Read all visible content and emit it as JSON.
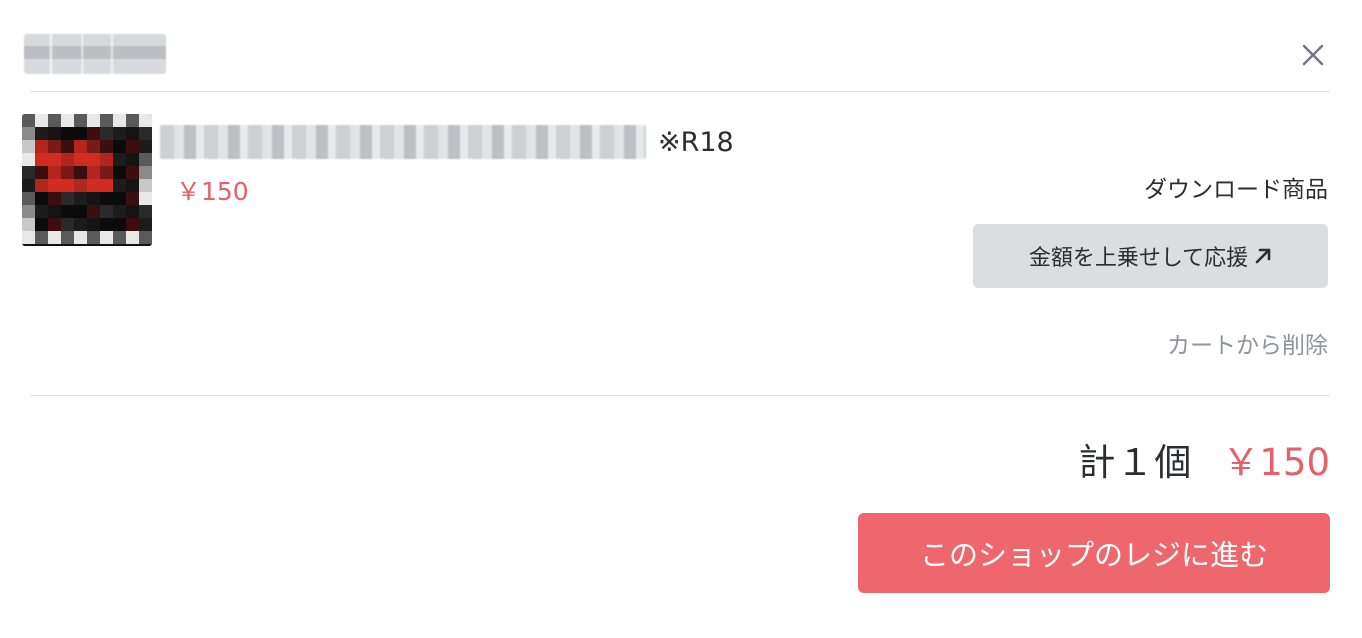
{
  "header": {
    "close_icon": "close-icon"
  },
  "item": {
    "title_suffix": "※R18",
    "price": "￥150",
    "type_label": "ダウンロード商品",
    "support_button_label": "金額を上乗せして応援",
    "support_button_icon": "external-arrow-icon",
    "remove_label": "カートから削除"
  },
  "summary": {
    "count_label": "計１個",
    "total_price": "￥150"
  },
  "checkout": {
    "label": "このショップのレジに進む"
  },
  "colors": {
    "accent": "#ee676d",
    "price": "#e5606a",
    "muted": "#8e949d",
    "button_gray": "#dcdde1",
    "divider": "#dcdfe3"
  }
}
